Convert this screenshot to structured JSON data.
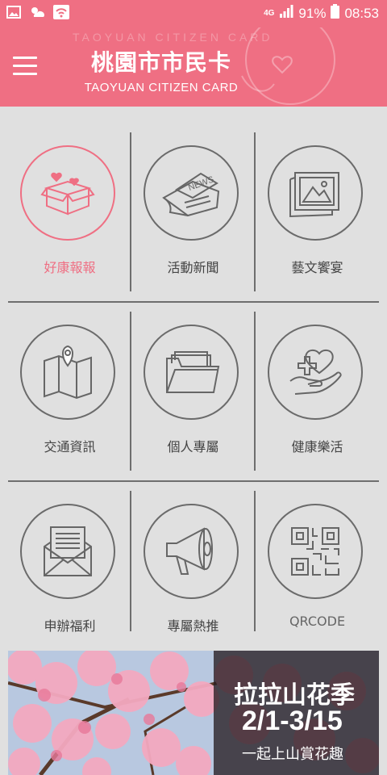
{
  "status_bar": {
    "network": "4G",
    "battery": "91%",
    "time": "08:53"
  },
  "header": {
    "title_zh": "桃園市市民卡",
    "title_en": "TAOYUAN CITIZEN CARD",
    "watermark": "TAOYUAN CITIZEN CARD",
    "bg_color": "#ef6f83"
  },
  "menu_items": [
    {
      "label": "好康報報",
      "icon": "gift-box-icon",
      "active": true
    },
    {
      "label": "活動新聞",
      "icon": "newspaper-icon",
      "active": false
    },
    {
      "label": "藝文饗宴",
      "icon": "picture-frame-icon",
      "active": false
    },
    {
      "label": "交通資訊",
      "icon": "map-pin-icon",
      "active": false
    },
    {
      "label": "個人專屬",
      "icon": "folder-icon",
      "active": false
    },
    {
      "label": "健康樂活",
      "icon": "heart-hand-icon",
      "active": false
    },
    {
      "label": "申辦福利",
      "icon": "envelope-icon",
      "active": false
    },
    {
      "label": "專屬熱推",
      "icon": "megaphone-icon",
      "active": false
    },
    {
      "label": "QRCODE",
      "icon": "qrcode-icon",
      "active": false
    }
  ],
  "banner": {
    "title": "拉拉山花季",
    "dates": "2/1-3/15",
    "subtitle": "一起上山賞花趣"
  }
}
